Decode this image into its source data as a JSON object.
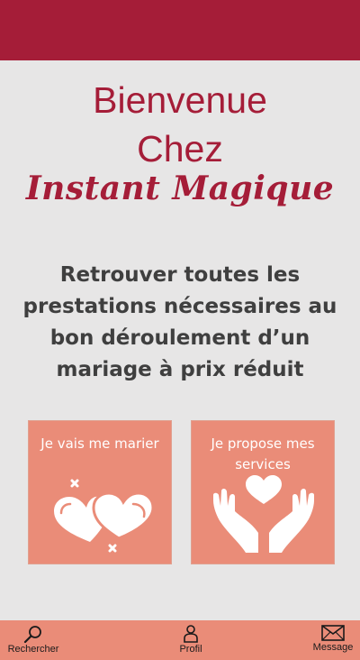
{
  "header": {
    "bar_color": "#a51d38"
  },
  "welcome": {
    "line1": "Bienvenue",
    "line2": "Chez",
    "brand": "Instant Magique"
  },
  "tagline": "Retrouver toutes les prestations nécessaires au bon déroulement d’un mariage à prix réduit",
  "cards": {
    "marier": {
      "label": "Je  vais me marier",
      "icon": "hearts-icon"
    },
    "services": {
      "label": "Je  propose mes services",
      "icon": "hands-heart-icon"
    }
  },
  "nav": {
    "search": {
      "label": "Rechercher",
      "icon": "search-icon"
    },
    "profil": {
      "label": "Profil",
      "icon": "profile-icon"
    },
    "message": {
      "label": "Message",
      "icon": "envelope-icon"
    }
  },
  "colors": {
    "accent": "#a51d38",
    "card": "#ea8c78",
    "background": "#e7e6e6",
    "text": "#3f3f3f"
  }
}
